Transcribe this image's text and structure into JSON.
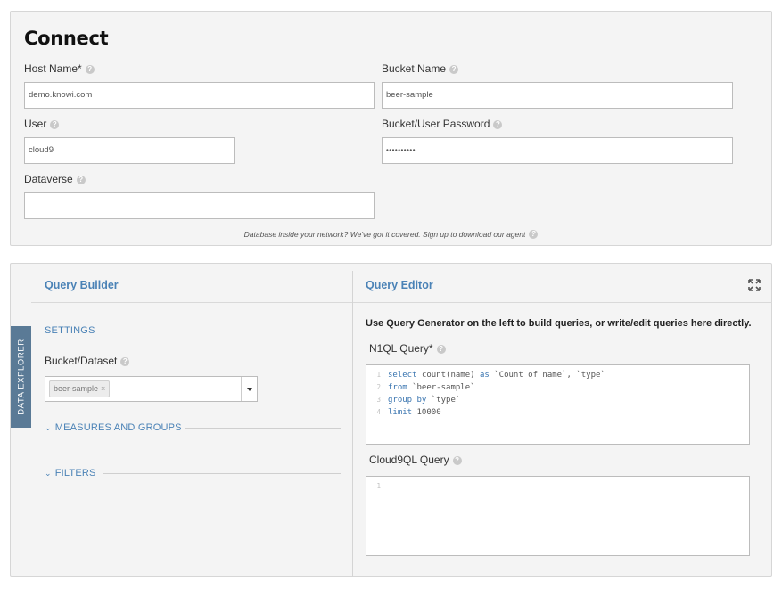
{
  "connect": {
    "title": "Connect",
    "host_name": {
      "label": "Host Name*",
      "value": "demo.knowi.com"
    },
    "bucket_name": {
      "label": "Bucket Name",
      "value": "beer-sample"
    },
    "user": {
      "label": "User",
      "value": "cloud9"
    },
    "bucket_password": {
      "label": "Bucket/User Password",
      "value": "••••••••••"
    },
    "dataverse": {
      "label": "Dataverse",
      "value": ""
    },
    "agent_note": "Database inside your network? We've got it covered. Sign up to download our agent"
  },
  "query_builder": {
    "tab_label": "DATA EXPLORER",
    "title": "Query Builder",
    "settings_label": "SETTINGS",
    "bucket_dataset_label": "Bucket/Dataset",
    "selected_tag": "beer-sample",
    "tag_remove": "×",
    "measures_label": "MEASURES AND GROUPS",
    "filters_label": "FILTERS"
  },
  "query_editor": {
    "title": "Query Editor",
    "intro": "Use Query Generator on the left to build queries, or write/edit queries here directly.",
    "n1ql_label": "N1QL Query*",
    "n1ql_lines": [
      {
        "num": "1",
        "kw": "select ",
        "rest": "count(name) ",
        "kw2": "as ",
        "rest2": "`Count of name`, `type`"
      },
      {
        "num": "2",
        "kw": "from ",
        "rest": "`beer-sample`",
        "kw2": "",
        "rest2": ""
      },
      {
        "num": "3",
        "kw": "group by ",
        "rest": "`type`",
        "kw2": "",
        "rest2": ""
      },
      {
        "num": "4",
        "kw": "limit ",
        "rest": "10000",
        "kw2": "",
        "rest2": ""
      }
    ],
    "cloud9ql_label": "Cloud9QL Query",
    "cloud9ql_lines": [
      {
        "num": "1"
      }
    ]
  },
  "colors": {
    "accent": "#4a82b6",
    "tab": "#5a7a96"
  }
}
